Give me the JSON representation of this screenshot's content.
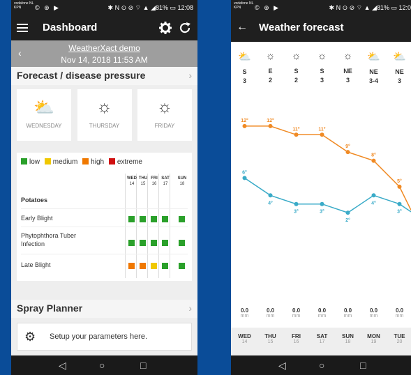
{
  "phone1": {
    "status": {
      "carrier": "vodafone NL KPN",
      "left_icons": "© ⊕ ▶",
      "right": "✱ N ⊙ ⊘ ⌔ ▲ ◢81% ▭ 12:08"
    },
    "appbar": {
      "title": "Dashboard",
      "menu_icon": "hamburger-icon",
      "settings_icon": "gear-icon",
      "refresh_icon": "refresh-icon"
    },
    "subheader": {
      "name": "WeatherXact demo",
      "datetime": "Nov 14, 2018 11:53 AM",
      "back": "‹"
    },
    "forecast": {
      "title": "Forecast / disease pressure",
      "chevron": "›",
      "days": [
        {
          "label": "WEDNESDAY",
          "icon": "partly-cloudy-icon",
          "glyph": "⛅"
        },
        {
          "label": "THURSDAY",
          "icon": "sun-icon",
          "glyph": "☼"
        },
        {
          "label": "FRIDAY",
          "icon": "sun-icon",
          "glyph": "☼"
        }
      ]
    },
    "legend": [
      {
        "label": "low",
        "color": "#2aa02a"
      },
      {
        "label": "medium",
        "color": "#f0c800"
      },
      {
        "label": "high",
        "color": "#f07800"
      },
      {
        "label": "extreme",
        "color": "#d01010"
      }
    ],
    "columns": [
      {
        "day": "WED",
        "num": "14"
      },
      {
        "day": "THU",
        "num": "15"
      },
      {
        "day": "FRI",
        "num": "16"
      },
      {
        "day": "SAT",
        "num": "17"
      },
      {
        "day": "SUN",
        "num": "18"
      }
    ],
    "crop": "Potatoes",
    "rows": [
      {
        "label": "Early Blight",
        "levels": [
          "low",
          "low",
          "low",
          "low",
          "low"
        ]
      },
      {
        "label": "Phytophthora Tuber Infection",
        "levels": [
          "low",
          "low",
          "low",
          "low",
          "low"
        ]
      },
      {
        "label": "Late Blight",
        "levels": [
          "high",
          "high",
          "medium",
          "low",
          "low"
        ]
      }
    ],
    "spray": {
      "title": "Spray Planner",
      "chevron": "›",
      "setup_text": "Setup your parameters here."
    },
    "nav": {
      "back": "◁",
      "home": "○",
      "recent": "□"
    }
  },
  "phone2": {
    "status": {
      "carrier": "vodafone NL KPN",
      "left_icons": "© ⊕ ▶",
      "right": "✱ N ⊙ ⊘ ⌔ ▲ ◢81% ▭ 12:0"
    },
    "appbar": {
      "title": "Weather forecast",
      "back_icon": "arrow-left-icon",
      "back": "←"
    },
    "days": [
      {
        "icon": "partly-cloudy-icon",
        "glyph": "⛅",
        "dir": "S",
        "speed": "3",
        "precip": "0.0",
        "unit": "mm",
        "day": "WED",
        "num": "14"
      },
      {
        "icon": "sun-icon",
        "glyph": "☼",
        "dir": "E",
        "speed": "2",
        "precip": "0.0",
        "unit": "mm",
        "day": "THU",
        "num": "15"
      },
      {
        "icon": "sun-icon",
        "glyph": "☼",
        "dir": "S",
        "speed": "2",
        "precip": "0.0",
        "unit": "mm",
        "day": "FRI",
        "num": "16"
      },
      {
        "icon": "sun-icon",
        "glyph": "☼",
        "dir": "S",
        "speed": "3",
        "precip": "0.0",
        "unit": "mm",
        "day": "SAT",
        "num": "17"
      },
      {
        "icon": "sun-icon",
        "glyph": "☼",
        "dir": "NE",
        "speed": "3",
        "precip": "0.0",
        "unit": "mm",
        "day": "SUN",
        "num": "18"
      },
      {
        "icon": "partly-cloudy-icon",
        "glyph": "⛅",
        "dir": "NE",
        "speed": "3-4",
        "precip": "0.0",
        "unit": "mm",
        "day": "MON",
        "num": "19"
      },
      {
        "icon": "partly-cloudy-icon",
        "glyph": "⛅",
        "dir": "NE",
        "speed": "3",
        "precip": "0.0",
        "unit": "mm",
        "day": "TUE",
        "num": "20"
      }
    ],
    "nav": {
      "back": "◁",
      "home": "○",
      "recent": "□"
    }
  },
  "chart_data": {
    "type": "line",
    "categories": [
      "WED",
      "THU",
      "FRI",
      "SAT",
      "SUN",
      "MON",
      "TUE"
    ],
    "series": [
      {
        "name": "",
        "color": "#f08a24",
        "values": [
          12,
          12,
          11,
          11,
          9,
          8,
          5
        ],
        "labels": [
          "12°",
          "12°",
          "11°",
          "11°",
          "9°",
          "8°",
          "5°"
        ]
      },
      {
        "name": "",
        "color": "#3aabc8",
        "values": [
          6,
          4,
          3,
          3,
          2,
          4,
          3
        ],
        "labels": [
          "6°",
          "4°",
          "3°",
          "3°",
          "2°",
          "4°",
          "3°"
        ]
      }
    ],
    "ylim": [
      0,
      14
    ]
  }
}
